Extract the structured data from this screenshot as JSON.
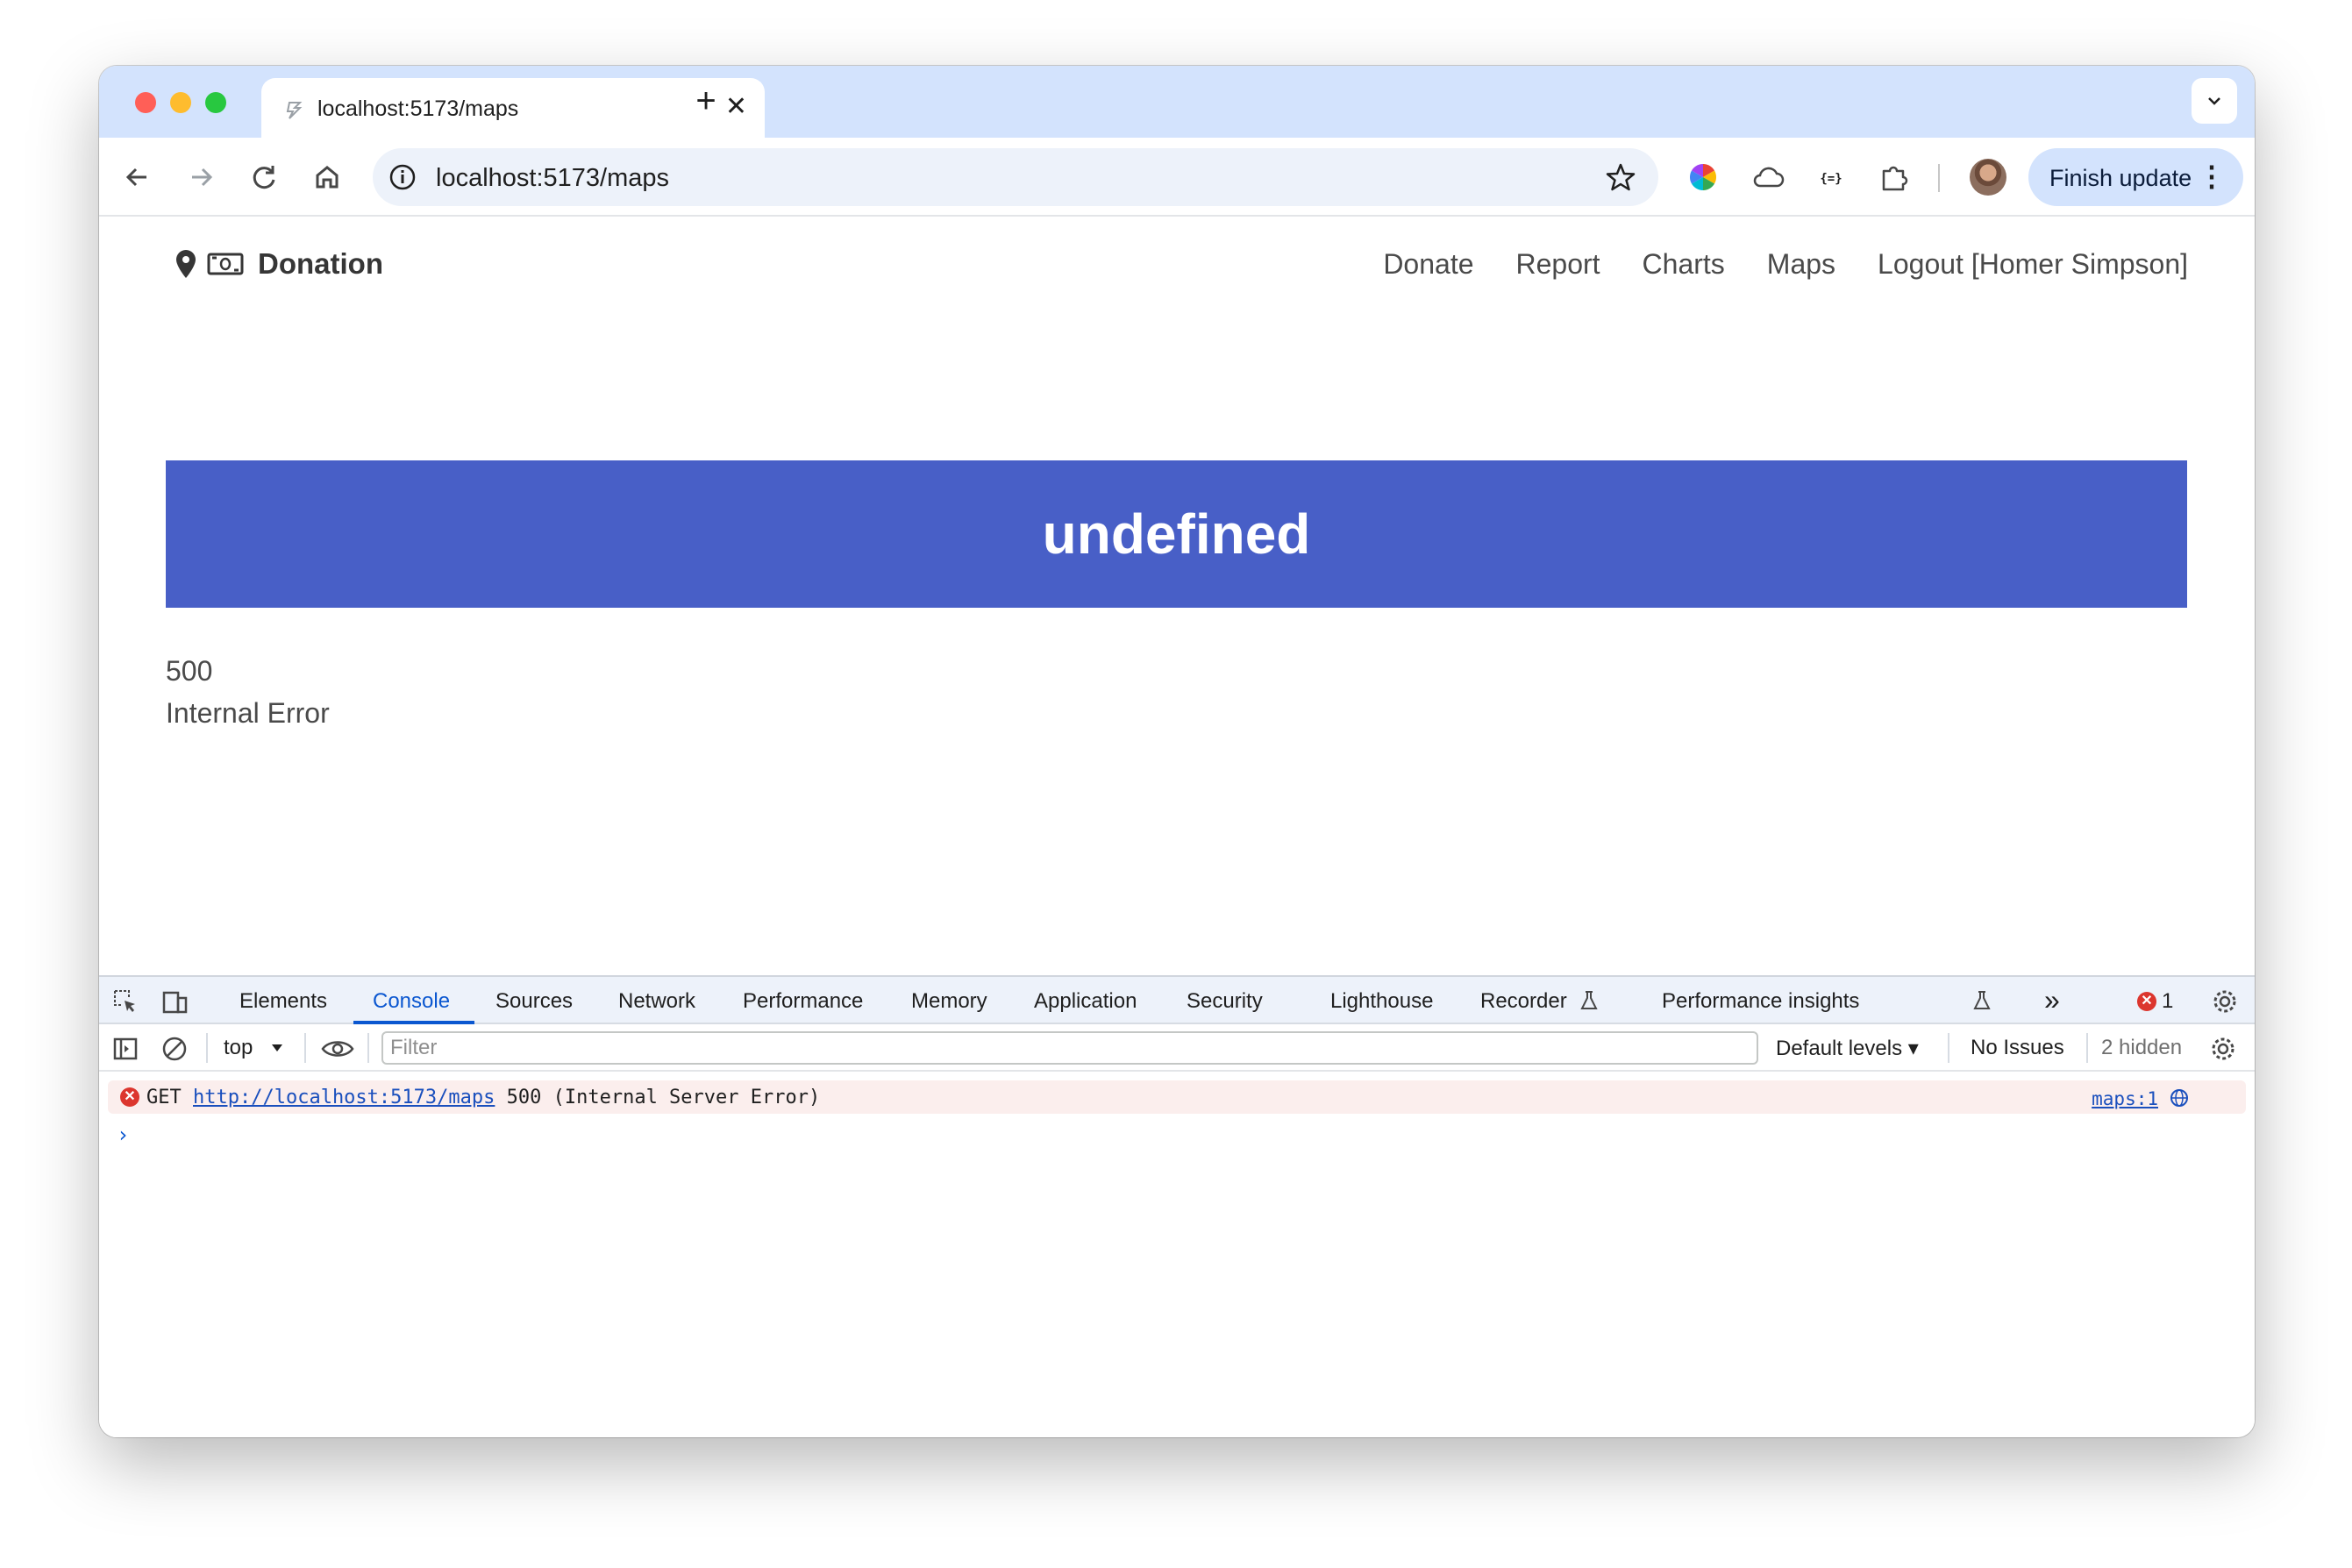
{
  "browser": {
    "tab_title": "localhost:5173/maps",
    "tab_close": "✕",
    "new_tab": "+",
    "url": "localhost:5173/maps",
    "finish_update": "Finish update",
    "menu_dots": "⋮",
    "tab_dropdown": "⌄"
  },
  "site": {
    "brand": "Donation",
    "nav": [
      "Donate",
      "Report",
      "Charts",
      "Maps",
      "Logout [Homer Simpson]"
    ],
    "hero_title": "undefined",
    "error_code": "500",
    "error_message": "Internal Error"
  },
  "devtools": {
    "tabs": [
      "Elements",
      "Console",
      "Sources",
      "Network",
      "Performance",
      "Memory",
      "Application",
      "Security",
      "Lighthouse",
      "Recorder",
      "Performance insights"
    ],
    "active_tab": "Console",
    "more_tabs": "»",
    "error_count": "1",
    "context": "top",
    "filter_placeholder": "Filter",
    "levels": "Default levels ▾",
    "issues": "No Issues",
    "hidden": "2 hidden",
    "console": {
      "method": "GET",
      "url": "http://localhost:5173/maps",
      "status": "500 (Internal Server Error)",
      "source": "maps:1",
      "prompt": "›"
    }
  },
  "colors": {
    "hero": "#485fc7",
    "tabstrip": "#d3e3fd",
    "devtools_active": "#0b57d0",
    "error": "#dc362e"
  },
  "icons": [
    "back-icon",
    "forward-icon",
    "reload-icon",
    "home-icon",
    "info-icon",
    "star-icon",
    "color-wheel-icon",
    "cloud-icon",
    "braces-icon",
    "puzzle-icon",
    "pin-icon",
    "money-icon",
    "inspect-icon",
    "device-icon",
    "gear-icon",
    "kebab-icon",
    "close-icon",
    "sidebar-icon",
    "clear-icon",
    "eye-icon",
    "globe-icon",
    "flask-icon"
  ]
}
